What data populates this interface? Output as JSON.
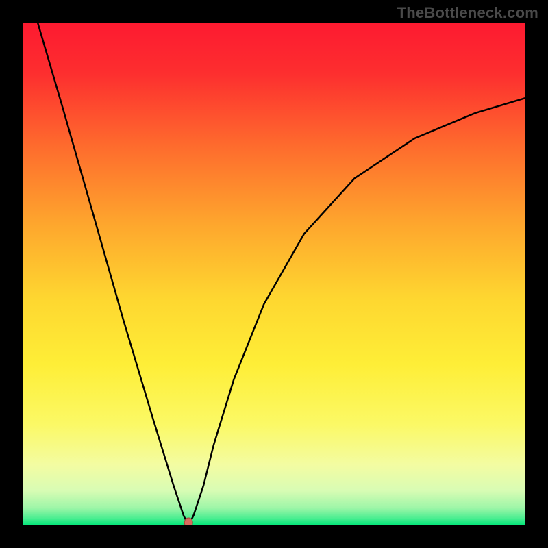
{
  "watermark": "TheBottleneck.com",
  "colors": {
    "frame": "#000000",
    "top": "#fd1a30",
    "mid": "#fee834",
    "bottom": "#00e678",
    "curve": "#000000",
    "marker_fill": "#d96a5e",
    "marker_stroke": "#a64436"
  },
  "chart_data": {
    "type": "line",
    "title": "",
    "xlabel": "",
    "ylabel": "",
    "xlim": [
      0,
      100
    ],
    "ylim": [
      0,
      100
    ],
    "grid": false,
    "annotations": [
      "TheBottleneck.com"
    ],
    "series": [
      {
        "name": "bottleneck-curve",
        "x": [
          3,
          8,
          14,
          20,
          26,
          30,
          32,
          33,
          34,
          36,
          38,
          42,
          48,
          56,
          66,
          78,
          90,
          100
        ],
        "y": [
          100,
          83,
          62,
          41,
          21,
          8,
          2,
          0,
          2,
          8,
          16,
          29,
          44,
          58,
          69,
          77,
          82,
          85
        ]
      }
    ],
    "marker": {
      "x": 33,
      "y": 0
    }
  }
}
